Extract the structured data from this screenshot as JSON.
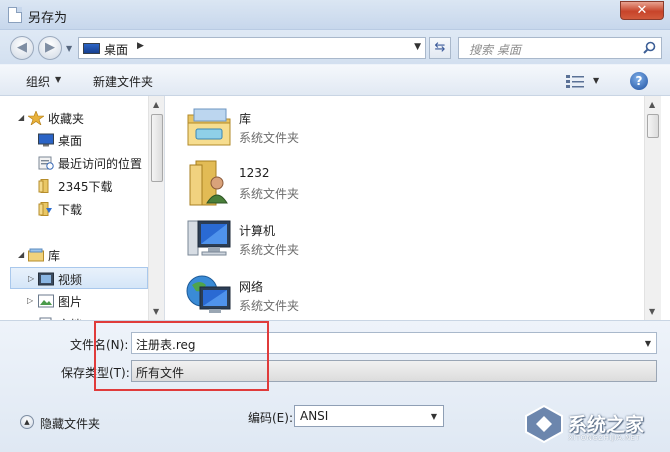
{
  "window": {
    "title": "另存为",
    "close_glyph": "✕"
  },
  "address": {
    "location": "桌面",
    "search_placeholder": "搜索 桌面"
  },
  "toolbar": {
    "organize": "组织",
    "new_folder": "新建文件夹",
    "help_glyph": "?"
  },
  "nav": {
    "items": [
      {
        "label": "收藏夹",
        "icon": "star-icon"
      },
      {
        "label": "桌面",
        "icon": "desktop-icon"
      },
      {
        "label": "最近访问的位置",
        "icon": "recent-places-icon"
      },
      {
        "label": "2345下载",
        "icon": "folder-icon"
      },
      {
        "label": "下载",
        "icon": "download-folder-icon"
      },
      {
        "label": "库",
        "icon": "library-icon"
      },
      {
        "label": "视频",
        "icon": "video-library-icon"
      },
      {
        "label": "图片",
        "icon": "pictures-library-icon"
      },
      {
        "label": "文档",
        "icon": "documents-library-icon"
      }
    ]
  },
  "files": [
    {
      "name": "库",
      "type": "系统文件夹",
      "icon": "library-folder-icon"
    },
    {
      "name": "1232",
      "type": "系统文件夹",
      "icon": "user-folder-icon"
    },
    {
      "name": "计算机",
      "type": "系统文件夹",
      "icon": "computer-icon"
    },
    {
      "name": "网络",
      "type": "系统文件夹",
      "icon": "network-icon"
    }
  ],
  "save": {
    "filename_label": "文件名(N):",
    "filename_value": "注册表.reg",
    "filetype_label": "保存类型(T):",
    "filetype_value": "所有文件",
    "encoding_label": "编码(E):",
    "encoding_value": "ANSI",
    "hide_folders": "隐藏文件夹"
  },
  "watermark": {
    "text": "系统之家",
    "sub": "XITONGZHIJIA.NET"
  },
  "colors": {
    "highlight_box": "#e03b3b",
    "accent": "#1e4f9e"
  }
}
